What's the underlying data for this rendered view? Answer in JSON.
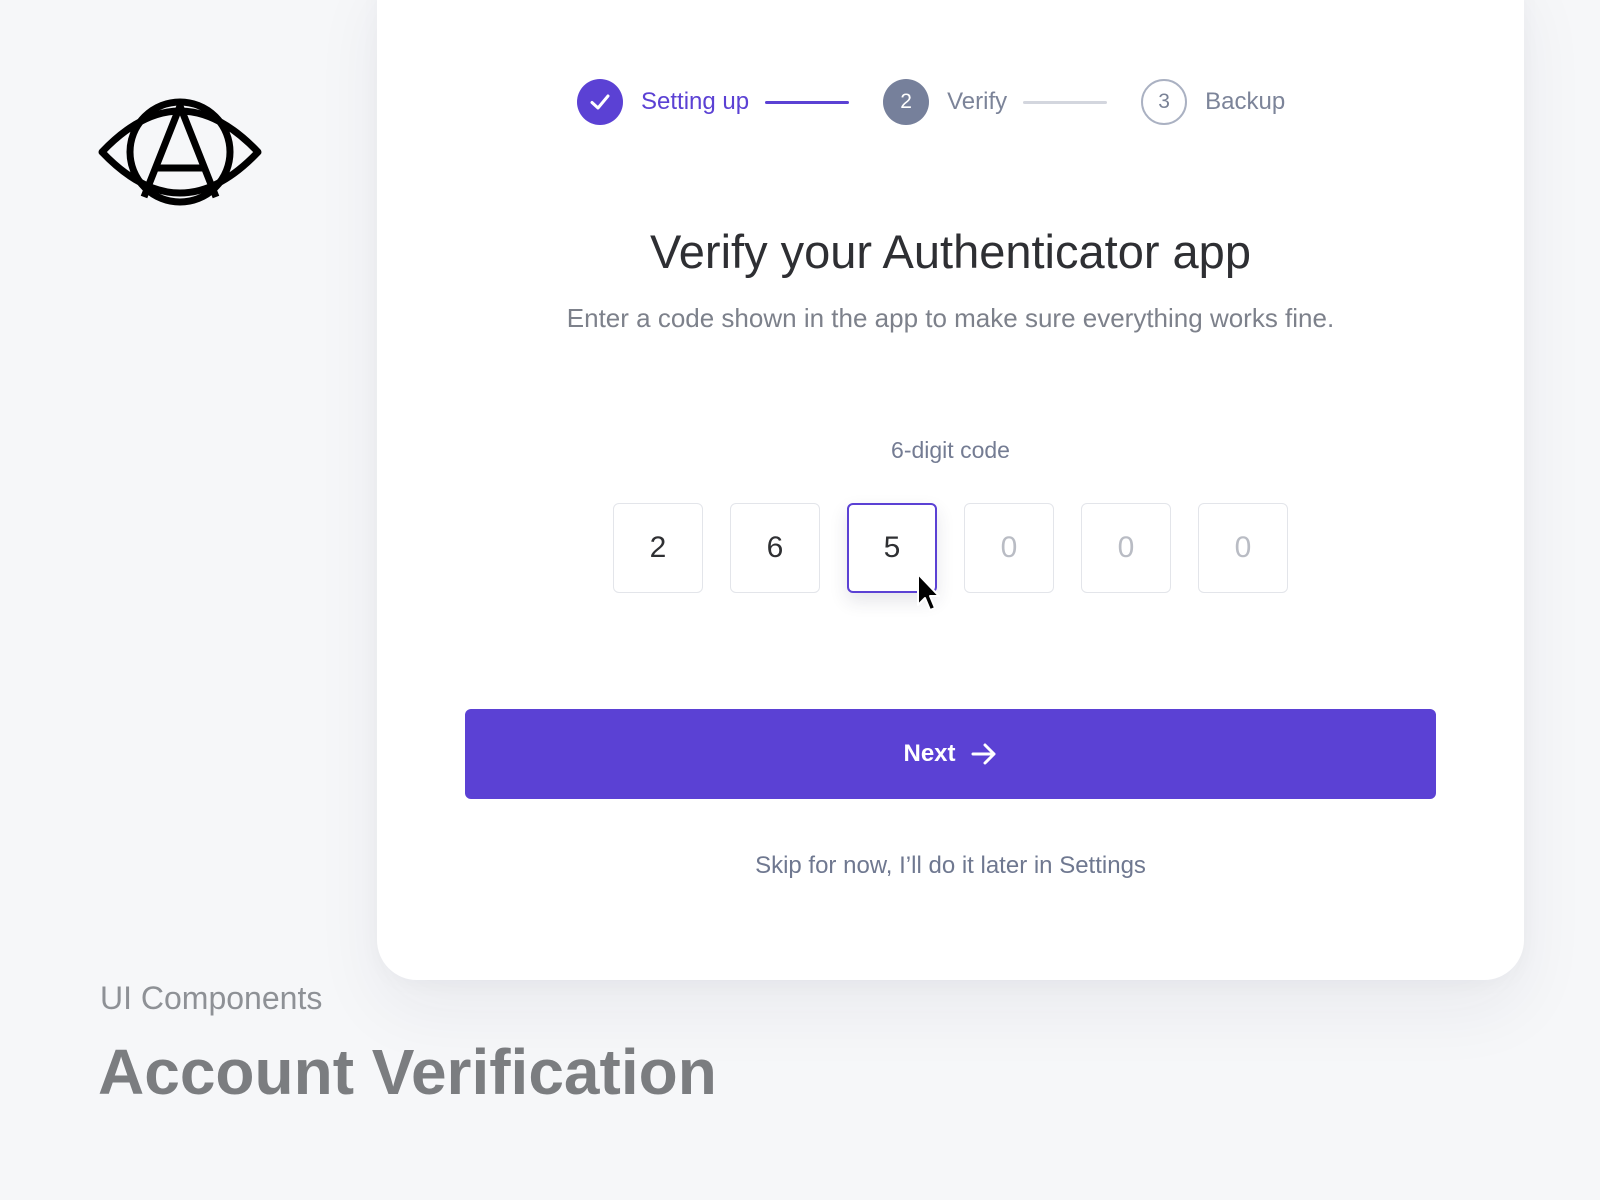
{
  "logo": {
    "name": "eye-a-logo"
  },
  "stepper": {
    "steps": [
      {
        "number": "",
        "label": "Setting up",
        "state": "done"
      },
      {
        "number": "2",
        "label": "Verify",
        "state": "active"
      },
      {
        "number": "3",
        "label": "Backup",
        "state": "todo"
      }
    ]
  },
  "main": {
    "title": "Verify your Authenticator app",
    "subtitle": "Enter a code shown in the app to make sure everything works fine.",
    "code_label": "6-digit code",
    "digits": [
      "2",
      "6",
      "5",
      "0",
      "0",
      "0"
    ],
    "next_label": "Next",
    "skip_label": "Skip for now, I’ll do it later in Settings"
  },
  "caption": {
    "category": "UI Components",
    "title": "Account Verification"
  },
  "colors": {
    "accent": "#5b41d4",
    "background": "#f6f7f9",
    "card": "#ffffff"
  }
}
